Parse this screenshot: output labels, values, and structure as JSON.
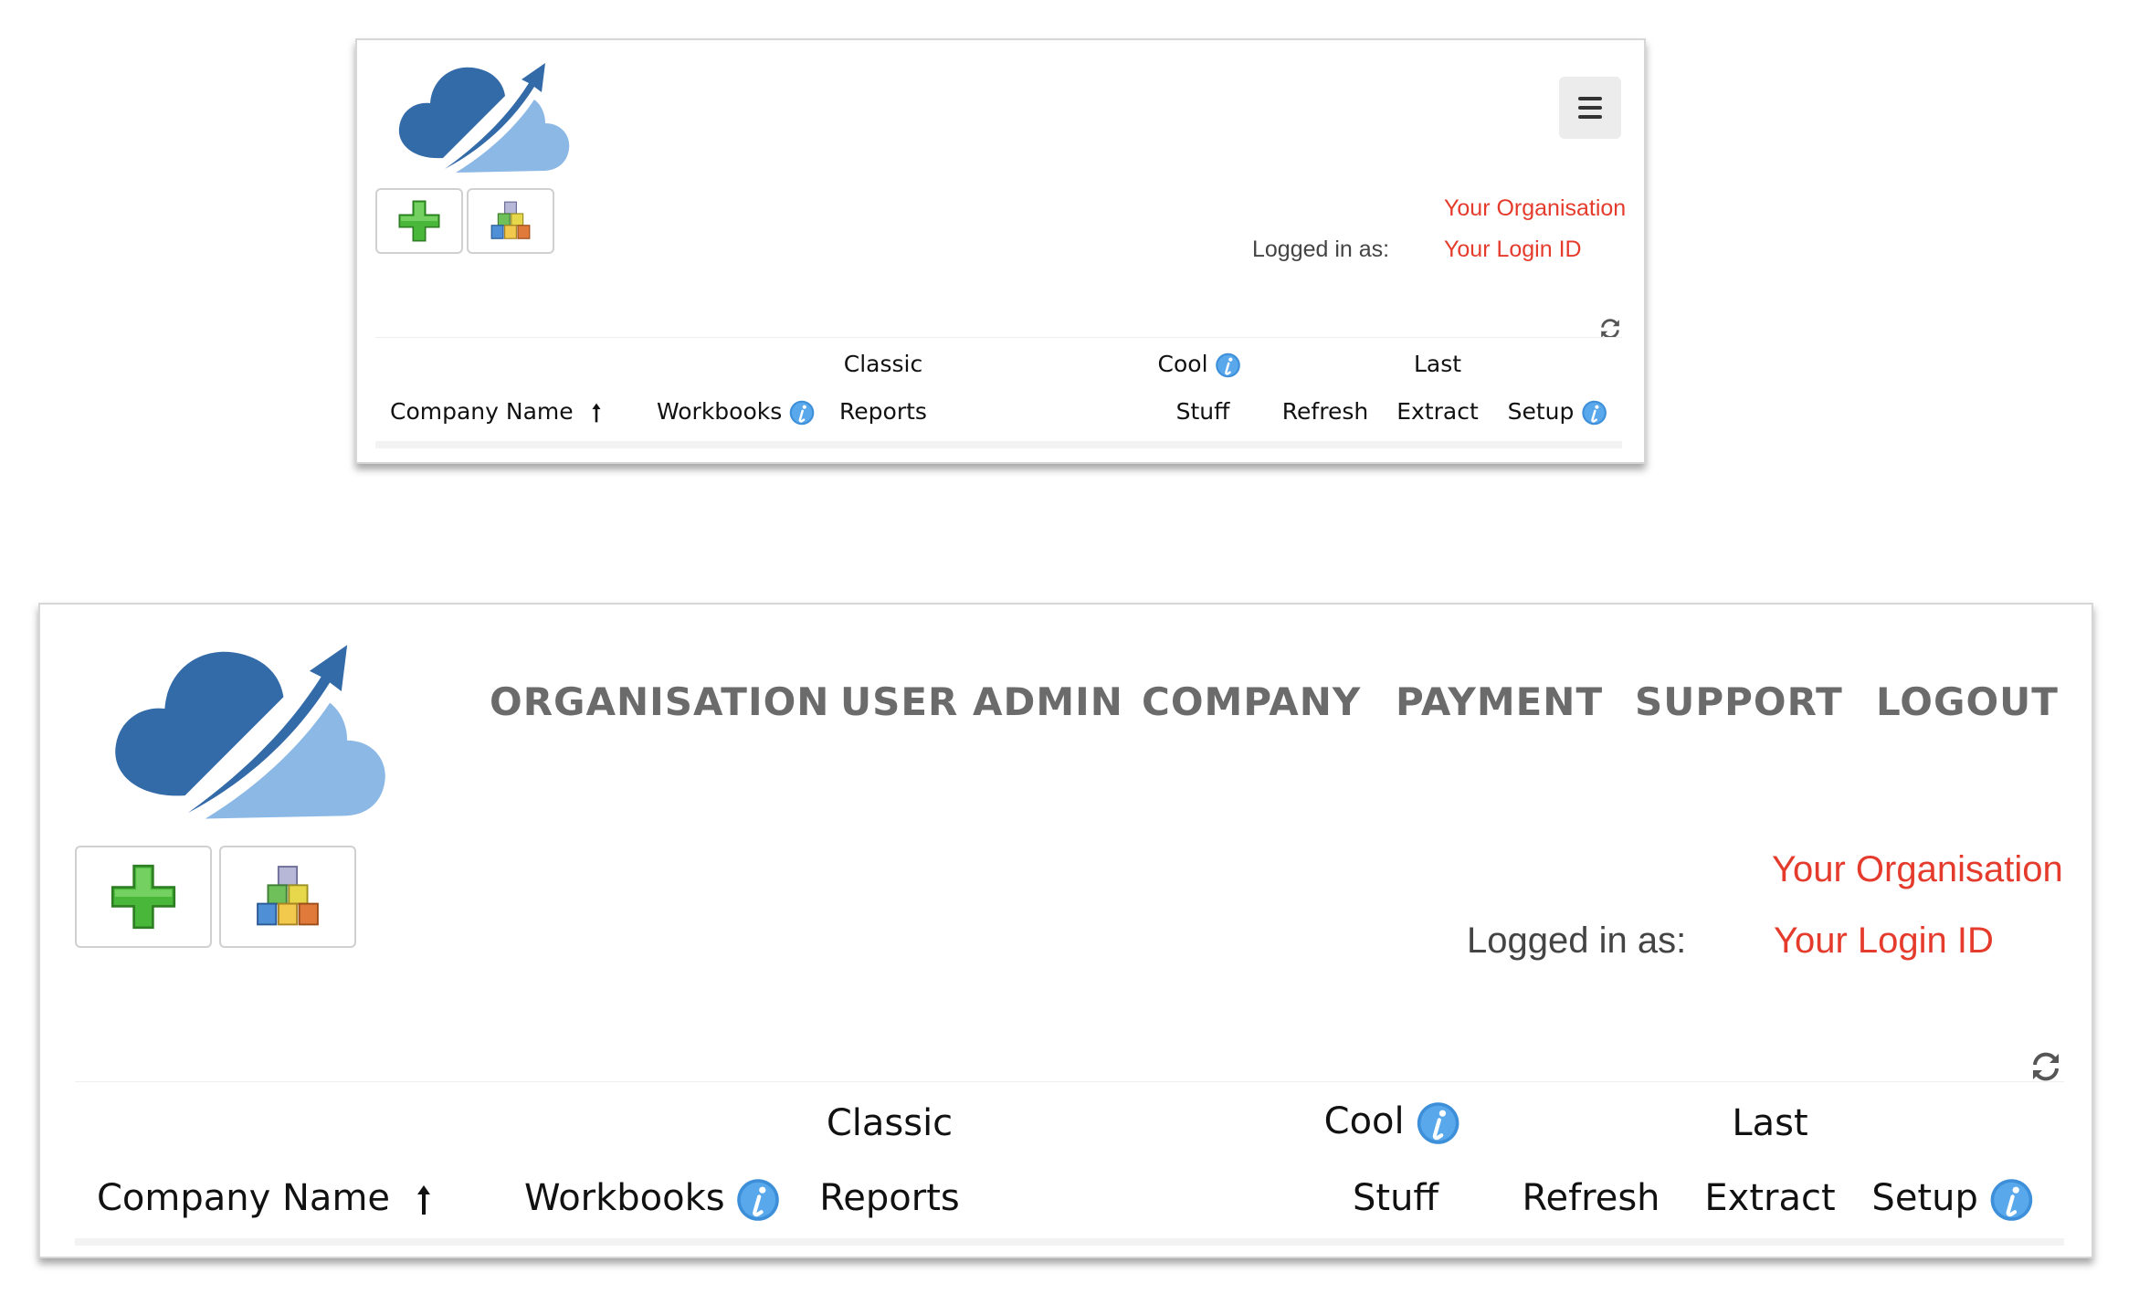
{
  "organisation": "Your Organisation",
  "logged_in_label": "Logged in as:",
  "login_id": "Your Login ID",
  "nav": [
    "ORGANISATION",
    "USER ADMIN",
    "COMPANY",
    "PAYMENT",
    "SUPPORT",
    "LOGOUT"
  ],
  "table_headers": {
    "company_name": "Company Name",
    "workbooks": "Workbooks",
    "classic": "Classic",
    "reports": "Reports",
    "cool": "Cool",
    "stuff": "Stuff",
    "refresh": "Refresh",
    "last": "Last",
    "extract": "Extract",
    "setup": "Setup"
  },
  "icons": {
    "logo": "cloud-arrow-logo-icon",
    "add": "plus-icon",
    "blocks": "blocks-icon",
    "menu": "hamburger-icon",
    "refresh": "refresh-icon",
    "info": "info-icon",
    "sort": "sort-ascending-icon"
  },
  "colors": {
    "accent_red": "#e53b2c",
    "cloud_dark": "#336aa8",
    "cloud_light": "#8cb8e6",
    "info_blue": "#3d8fd9",
    "nav_gray": "#6b6b6b"
  }
}
